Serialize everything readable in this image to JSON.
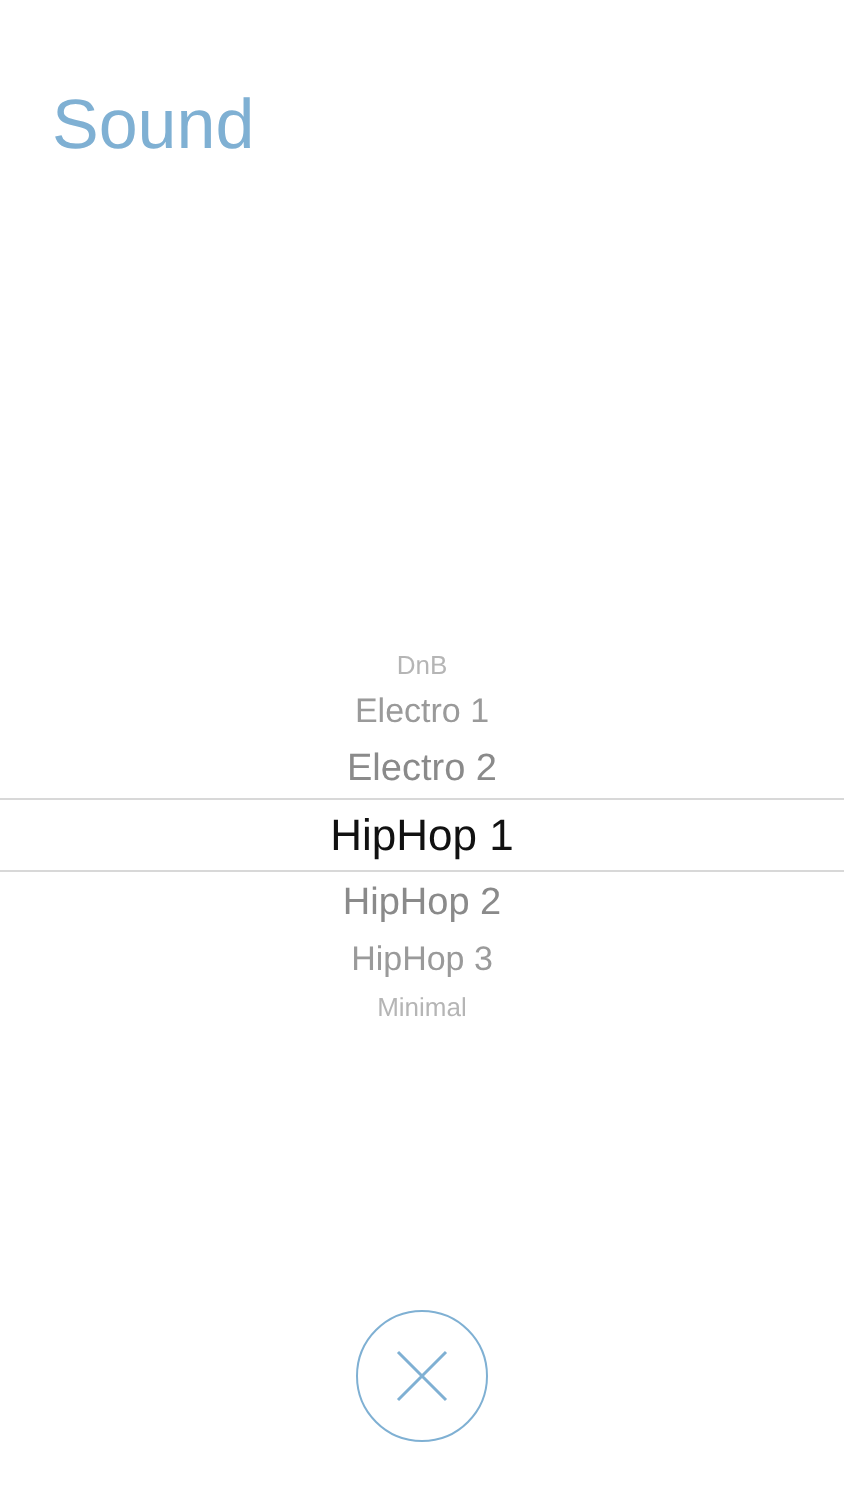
{
  "title": "Sound",
  "picker": {
    "items": [
      {
        "label": "DnB",
        "selected": false
      },
      {
        "label": "Electro 1",
        "selected": false
      },
      {
        "label": "Electro 2",
        "selected": false
      },
      {
        "label": "HipHop 1",
        "selected": true
      },
      {
        "label": "HipHop 2",
        "selected": false
      },
      {
        "label": "HipHop 3",
        "selected": false
      },
      {
        "label": "Minimal",
        "selected": false
      }
    ]
  }
}
